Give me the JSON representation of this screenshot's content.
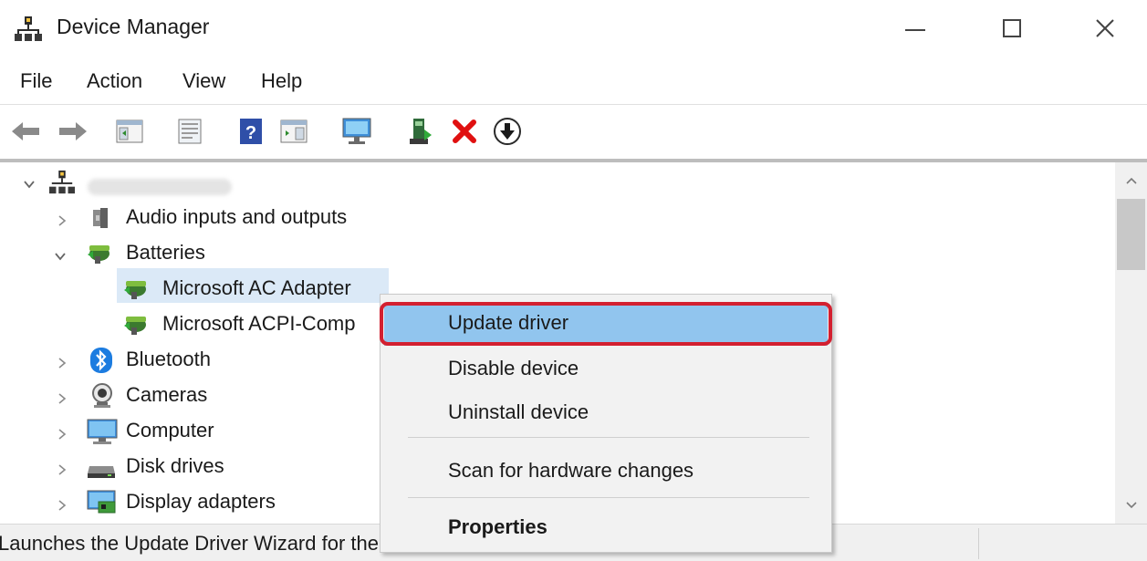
{
  "window": {
    "title": "Device Manager",
    "icon": "device-manager-icon",
    "controls": [
      "minimize-icon",
      "maximize-icon",
      "close-icon"
    ]
  },
  "menu": {
    "items": [
      "File",
      "Action",
      "View",
      "Help"
    ]
  },
  "toolbar": {
    "icons": [
      "back-arrow-icon",
      "forward-arrow-icon",
      "show-hide-console-tree-icon",
      "properties-icon",
      "help-icon",
      "show-action-pane-icon",
      "scan-hardware-icon",
      "update-driver-icon",
      "uninstall-device-icon",
      "disable-device-icon"
    ]
  },
  "tree": {
    "items": [
      {
        "label": "Audio inputs and outputs",
        "icon": "speaker-icon",
        "expanded": false
      },
      {
        "label": "Batteries",
        "icon": "battery-icon",
        "expanded": true
      },
      {
        "label": "Microsoft AC Adapter",
        "icon": "battery-icon",
        "selected": true
      },
      {
        "label": "Microsoft ACPI-Comp",
        "icon": "battery-icon"
      },
      {
        "label": "Bluetooth",
        "icon": "bluetooth-icon",
        "expanded": false
      },
      {
        "label": "Cameras",
        "icon": "camera-icon",
        "expanded": false
      },
      {
        "label": "Computer",
        "icon": "monitor-icon",
        "expanded": false
      },
      {
        "label": "Disk drives",
        "icon": "disk-drive-icon",
        "expanded": false
      },
      {
        "label": "Display adapters",
        "icon": "display-adapter-icon",
        "expanded": false
      }
    ]
  },
  "context_menu": {
    "items": [
      "Update driver",
      "Disable device",
      "Uninstall device",
      "Scan for hardware changes",
      "Properties"
    ],
    "highlighted": "Update driver"
  },
  "status": {
    "text": "Launches the Update Driver Wizard for the selected device."
  },
  "colors": {
    "highlight": "#91c5ee",
    "selection": "#dbe9f7",
    "annotation_outline": "#d32030",
    "uninstall_x": "#e01010"
  }
}
